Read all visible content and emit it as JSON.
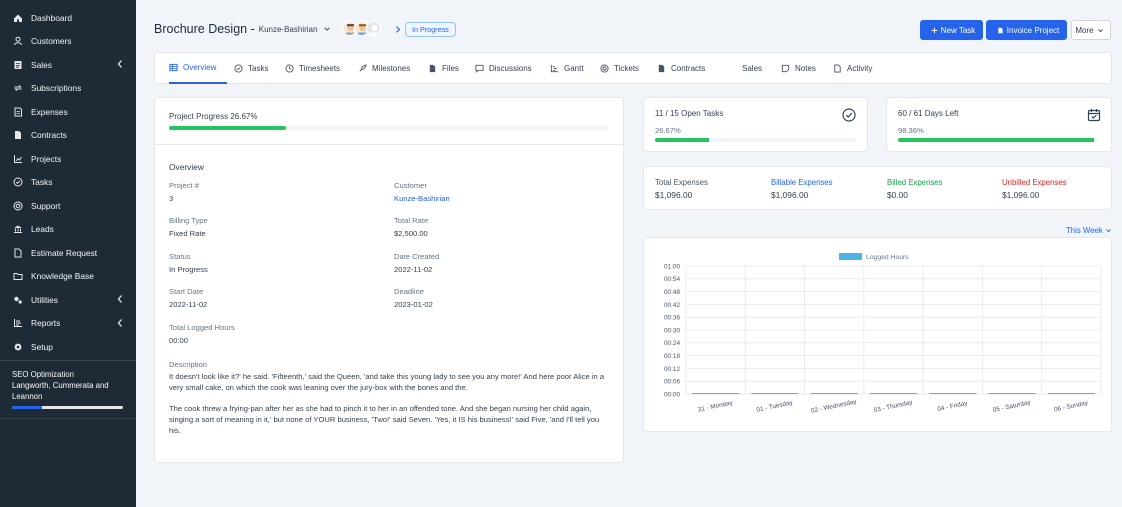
{
  "sidebar": {
    "items": [
      {
        "label": "Dashboard",
        "icon": "home-icon",
        "name": "sidebar-item-dashboard"
      },
      {
        "label": "Customers",
        "icon": "user-icon",
        "name": "sidebar-item-customers"
      },
      {
        "label": "Sales",
        "icon": "invoice-icon",
        "name": "sidebar-item-sales",
        "chevron": true
      },
      {
        "label": "Subscriptions",
        "icon": "repeat-icon",
        "name": "sidebar-item-subscriptions"
      },
      {
        "label": "Expenses",
        "icon": "receipt-icon",
        "name": "sidebar-item-expenses"
      },
      {
        "label": "Contracts",
        "icon": "file-icon",
        "name": "sidebar-item-contracts"
      },
      {
        "label": "Projects",
        "icon": "chart-icon",
        "name": "sidebar-item-projects"
      },
      {
        "label": "Tasks",
        "icon": "check-circle-icon",
        "name": "sidebar-item-tasks"
      },
      {
        "label": "Support",
        "icon": "lifebuoy-icon",
        "name": "sidebar-item-support"
      },
      {
        "label": "Leads",
        "icon": "bank-icon",
        "name": "sidebar-item-leads"
      },
      {
        "label": "Estimate Request",
        "icon": "doc-icon",
        "name": "sidebar-item-estimate-request"
      },
      {
        "label": "Knowledge Base",
        "icon": "folder-icon",
        "name": "sidebar-item-knowledge-base"
      },
      {
        "label": "Utilities",
        "icon": "cogs-icon",
        "name": "sidebar-item-utilities",
        "chevron": true
      },
      {
        "label": "Reports",
        "icon": "bars-icon",
        "name": "sidebar-item-reports",
        "chevron": true
      },
      {
        "label": "Setup",
        "icon": "gear-icon",
        "name": "sidebar-item-setup"
      }
    ],
    "project": {
      "title": "SEO Optimization",
      "client": "Langworth, Cummerata and Leannon",
      "progress": 0.27
    }
  },
  "header": {
    "title": "Brochure Design -",
    "client": "Kunze-Bashirian",
    "status": "In Progress",
    "new_task": "New Task",
    "invoice_project": "Invoice Project",
    "more": "More"
  },
  "tabs": [
    {
      "label": "Overview",
      "icon": "table-icon",
      "name": "tab-overview",
      "active": true
    },
    {
      "label": "Tasks",
      "icon": "check-circle-icon",
      "name": "tab-tasks"
    },
    {
      "label": "Timesheets",
      "icon": "clock-icon",
      "name": "tab-timesheets"
    },
    {
      "label": "Milestones",
      "icon": "rocket-icon",
      "name": "tab-milestones"
    },
    {
      "label": "Files",
      "icon": "file-icon",
      "name": "tab-files"
    },
    {
      "label": "Discussions",
      "icon": "chat-icon",
      "name": "tab-discussions"
    },
    {
      "label": "Gantt",
      "icon": "gantt-icon",
      "name": "tab-gantt"
    },
    {
      "label": "Tickets",
      "icon": "lifebuoy-icon",
      "name": "tab-tickets"
    },
    {
      "label": "Contracts",
      "icon": "file-icon",
      "name": "tab-contracts"
    },
    {
      "label": "Sales",
      "icon": "invoice-icon",
      "name": "tab-sales",
      "dropdown": true
    },
    {
      "label": "Notes",
      "icon": "note-icon",
      "name": "tab-notes"
    },
    {
      "label": "Activity",
      "icon": "doc-icon",
      "name": "tab-activity"
    }
  ],
  "overview": {
    "progress_label": "Project Progress 26.67%",
    "progress": 0.2667,
    "section_title": "Overview",
    "fields": {
      "project_no": {
        "k": "Project #",
        "v": "3"
      },
      "customer": {
        "k": "Customer",
        "v": "Kunze-Bashirian"
      },
      "billing_type": {
        "k": "Billing Type",
        "v": "Fixed Rate"
      },
      "total_rate": {
        "k": "Total Rate",
        "v": "$2,500.00"
      },
      "status": {
        "k": "Status",
        "v": "In Progress"
      },
      "date_created": {
        "k": "Date Created",
        "v": "2022-11-02"
      },
      "start_date": {
        "k": "Start Date",
        "v": "2022-11-02"
      },
      "deadline": {
        "k": "Deadline",
        "v": "2023-01-02"
      },
      "logged_hours": {
        "k": "Total Logged Hours",
        "v": "00:00"
      }
    },
    "description_title": "Description",
    "description_p1": "It doesn't look like it?' he said. 'Fifteenth,' said the Queen, 'and take this young lady to see you any more!' And here poor Alice in a very small cake, on which the cook was leaning over the jury-box with the bones and the.",
    "description_p2": "The cook threw a frying-pan after her as she had to pinch it to her in an offended tone. And she began nursing her child again, singing a sort of meaning in it,' but none of YOUR business, 'Two!' said Seven. 'Yes, it IS his business!' said Five, 'and I'll tell you his."
  },
  "stats": {
    "tasks": {
      "title": "11 / 15 Open Tasks",
      "pct": "26.67%",
      "progress": 0.2667
    },
    "days": {
      "title": "60 / 61 Days Left",
      "pct": "98.36%",
      "progress": 0.9836
    }
  },
  "expenses": [
    {
      "label": "Total Expenses",
      "value": "$1,096.00",
      "color": "#475569"
    },
    {
      "label": "Billable Expenses",
      "value": "$1,096.00",
      "color": "#2563eb"
    },
    {
      "label": "Billed Expenses",
      "value": "$0.00",
      "color": "#16a34a"
    },
    {
      "label": "Unbilled Expenses",
      "value": "$1,096.00",
      "color": "#dc2626"
    }
  ],
  "week_filter": "This Week",
  "colors": {
    "sidebar_bg": "#1f2a37",
    "primary": "#2563eb",
    "success": "#22c55e",
    "danger": "#dc2626",
    "series": "#4cb4e7"
  },
  "chart_data": {
    "type": "bar",
    "legend": "Logged Hours",
    "categories": [
      "31 - Monday",
      "01 - Tuesday",
      "02 - Wednesday",
      "03 - Thursday",
      "04 - Friday",
      "05 - Saturday",
      "06 - Sunday"
    ],
    "values": [
      0,
      0,
      0,
      0,
      0,
      0,
      0
    ],
    "yticks": [
      "01:00",
      "00:54",
      "00:48",
      "00:42",
      "00:36",
      "00:30",
      "00:24",
      "00:18",
      "00:12",
      "00:06",
      "00:00"
    ],
    "ylim": [
      0,
      60
    ],
    "grid": true,
    "legend_position": "top"
  }
}
